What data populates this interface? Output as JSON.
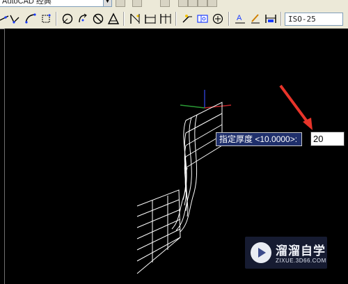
{
  "toolbar": {
    "workspace_combo": "AutoCAD 经典",
    "dim_style": "ISO-25",
    "tools_row": [
      "ray-tool",
      "polyline-tool",
      "arc-tool",
      "region-tool",
      "circle-tool",
      "redo-tool",
      "no-tool",
      "triangle-tool",
      "aligned-dim-tool",
      "baseline-dim-tool",
      "continue-dim-tool",
      "leader-tool",
      "tolerance-tool",
      "center-mark-tool",
      "dim-edit-tool",
      "dim-text-edit-tool",
      "dim-update-tool"
    ]
  },
  "command": {
    "prompt_label": "指定厚度 <10.0000>:",
    "input_value": "20"
  },
  "watermark": {
    "brand": "溜溜自学",
    "url": "ZIXUE.3D66.COM"
  },
  "colors": {
    "canvas_bg": "#000000",
    "wireframe": "#ffffff",
    "prompt_bg": "#1f2f6b",
    "arrow": "#e8342a",
    "ucs_x": "#c0262a",
    "ucs_y": "#2a9a35",
    "ucs_z": "#2a3ac0"
  }
}
